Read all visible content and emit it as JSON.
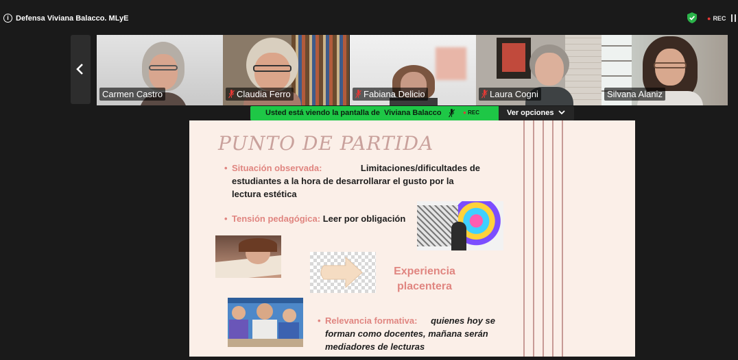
{
  "meeting": {
    "title": "Defensa Viviana Balacco. MLyE",
    "info_icon": "info-icon",
    "security_icon": "shield-check-icon",
    "recording_label": "REC",
    "pause_icon": "pause-icon"
  },
  "gallery": {
    "prev_icon": "chevron-left-icon",
    "participants": [
      {
        "name": "Carmen Castro",
        "muted": false
      },
      {
        "name": "Claudia Ferro",
        "muted": true
      },
      {
        "name": "Fabiana Delicio",
        "muted": true
      },
      {
        "name": "Laura Cogni",
        "muted": true
      },
      {
        "name": "Silvana Alaniz",
        "muted": false
      }
    ]
  },
  "share_banner": {
    "text_prefix": "Usted está viendo la pantalla de",
    "presenter": "Viviana Balacco",
    "rec_label": "REC",
    "options_label": "Ver opciones",
    "color": "#1ec746"
  },
  "slide": {
    "title": "PUNTO DE PARTIDA",
    "bullet1_label": "Situación observada:",
    "bullet1_line1": "Limitaciones/dificultades de",
    "bullet1_line2": "estudiantes a la hora  de desarrollarar el gusto por la",
    "bullet1_line3": "lectura estética",
    "bullet2_label": "Tensión pedagógica:",
    "bullet2_text": "Leer por obligación",
    "experience_line1": "Experiencia",
    "experience_line2": "placentera",
    "bullet3_label": "Relevancia formativa:",
    "bullet3_line1": "quienes hoy se",
    "bullet3_line2": "forman como docentes, mañana serán",
    "bullet3_line3": "mediadores de lecturas",
    "accent_color": "#e08580",
    "background_color": "#fbefe8"
  }
}
